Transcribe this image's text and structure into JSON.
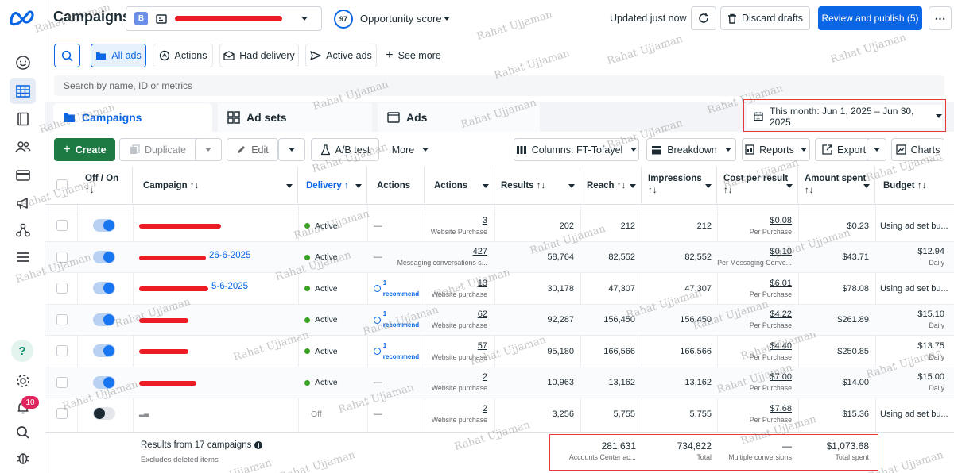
{
  "app": {
    "title": "Campaigns"
  },
  "account": {
    "initial": "B"
  },
  "opportunity": {
    "score": "97",
    "label": "Opportunity score"
  },
  "top_actions": {
    "updated": "Updated just now",
    "discard": "Discard drafts",
    "publish": "Review and publish (5)"
  },
  "filters": {
    "all_ads": "All ads",
    "actions": "Actions",
    "had_delivery": "Had delivery",
    "active_ads": "Active ads",
    "see_more": "See more",
    "search_placeholder": "Search by name, ID or metrics"
  },
  "tabs": [
    {
      "label": "Campaigns"
    },
    {
      "label": "Ad sets"
    },
    {
      "label": "Ads"
    }
  ],
  "date_range": "This month: Jun 1, 2025 – Jun 30, 2025",
  "toolbar": {
    "create": "Create",
    "duplicate": "Duplicate",
    "edit": "Edit",
    "ab_test": "A/B test",
    "more": "More",
    "columns": "Columns: FT-Tofayel",
    "breakdown": "Breakdown",
    "reports": "Reports",
    "export": "Export",
    "charts": "Charts"
  },
  "columns": {
    "off_on": "Off / On",
    "campaign": "Campaign",
    "delivery": "Delivery",
    "actions1": "Actions",
    "actions2": "Actions",
    "results": "Results",
    "reach": "Reach",
    "impressions": "Impressions",
    "cost_per_result": "Cost per result",
    "amount_spent": "Amount spent",
    "budget": "Budget"
  },
  "rows": [
    {
      "on": true,
      "campaign_suffix": "",
      "delivery": "Active",
      "recommend": "",
      "actions_val": "3",
      "actions_sub": "Website Purchase",
      "results": "202",
      "reach": "212",
      "impressions": "212",
      "cpr": "$0.08",
      "cpr_sub": "Per Purchase",
      "spent": "$0.23",
      "budget": "Using ad set bu...",
      "budget_sub": ""
    },
    {
      "on": true,
      "campaign_suffix": "26-6-2025",
      "delivery": "Active",
      "recommend": "",
      "actions_val": "427",
      "actions_sub": "Messaging conversations s...",
      "results": "58,764",
      "reach": "82,552",
      "impressions": "82,552",
      "cpr": "$0.10",
      "cpr_sub": "Per Messaging Conve...",
      "spent": "$43.71",
      "budget": "$12.94",
      "budget_sub": "Daily"
    },
    {
      "on": true,
      "campaign_suffix": "5-6-2025",
      "delivery": "Active",
      "recommend": "1 recommend",
      "actions_val": "13",
      "actions_sub": "Website purchase",
      "results": "30,178",
      "reach": "47,307",
      "impressions": "47,307",
      "cpr": "$6.01",
      "cpr_sub": "Per Purchase",
      "spent": "$78.08",
      "budget": "Using ad set bu...",
      "budget_sub": ""
    },
    {
      "on": true,
      "campaign_suffix": "",
      "delivery": "Active",
      "recommend": "1 recommend",
      "actions_val": "62",
      "actions_sub": "Website purchase",
      "results": "92,287",
      "reach": "156,450",
      "impressions": "156,450",
      "cpr": "$4.22",
      "cpr_sub": "Per Purchase",
      "spent": "$261.89",
      "budget": "$15.10",
      "budget_sub": "Daily"
    },
    {
      "on": true,
      "campaign_suffix": "",
      "delivery": "Active",
      "recommend": "1 recommend",
      "actions_val": "57",
      "actions_sub": "Website purchase",
      "results": "95,180",
      "reach": "166,566",
      "impressions": "166,566",
      "cpr": "$4.40",
      "cpr_sub": "Per Purchase",
      "spent": "$250.85",
      "budget": "$13.75",
      "budget_sub": "Daily"
    },
    {
      "on": true,
      "campaign_suffix": "",
      "delivery": "Active",
      "recommend": "",
      "actions_val": "2",
      "actions_sub": "Website purchase",
      "results": "10,963",
      "reach": "13,162",
      "impressions": "13,162",
      "cpr": "$7.00",
      "cpr_sub": "Per Purchase",
      "spent": "$14.00",
      "budget": "$15.00",
      "budget_sub": "Daily"
    },
    {
      "on": false,
      "campaign_suffix": "",
      "delivery": "Off",
      "recommend": "",
      "actions_val": "2",
      "actions_sub": "Website purchase",
      "results": "3,256",
      "reach": "5,755",
      "impressions": "5,755",
      "cpr": "$7.68",
      "cpr_sub": "Per Purchase",
      "spent": "$15.36",
      "budget": "Using ad set bu...",
      "budget_sub": ""
    }
  ],
  "summary": {
    "title": "Results from 17 campaigns",
    "note": "Excludes deleted items",
    "reach": "281,631",
    "reach_sub": "Accounts Center ac...",
    "impressions": "734,822",
    "impressions_sub": "Total",
    "cpr": "—",
    "cpr_sub": "Multiple conversions",
    "spent": "$1,073.68",
    "spent_sub": "Total spent"
  },
  "notifications": {
    "count": "10"
  },
  "watermark": "Rahat Ujjaman"
}
